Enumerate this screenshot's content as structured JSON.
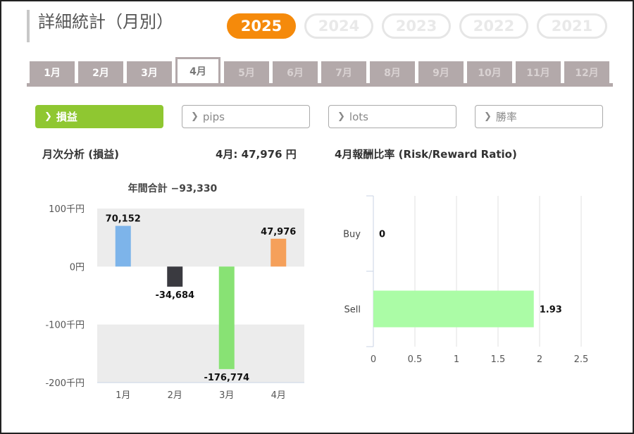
{
  "page_title": "詳細統計（月別）",
  "years": [
    {
      "label": "2025",
      "active": true
    },
    {
      "label": "2024",
      "active": false
    },
    {
      "label": "2023",
      "active": false
    },
    {
      "label": "2022",
      "active": false
    },
    {
      "label": "2021",
      "active": false
    }
  ],
  "month_tabs": [
    {
      "label": "1月",
      "state": "normal"
    },
    {
      "label": "2月",
      "state": "normal"
    },
    {
      "label": "3月",
      "state": "normal"
    },
    {
      "label": "4月",
      "state": "active"
    },
    {
      "label": "5月",
      "state": "dim"
    },
    {
      "label": "6月",
      "state": "dim"
    },
    {
      "label": "7月",
      "state": "dim"
    },
    {
      "label": "8月",
      "state": "dim"
    },
    {
      "label": "9月",
      "state": "dim"
    },
    {
      "label": "10月",
      "state": "dim"
    },
    {
      "label": "11月",
      "state": "dim"
    },
    {
      "label": "12月",
      "state": "dim"
    }
  ],
  "metric_buttons": [
    {
      "label": "損益",
      "active": true
    },
    {
      "label": "pips",
      "active": false
    },
    {
      "label": "lots",
      "active": false
    },
    {
      "label": "勝率",
      "active": false
    }
  ],
  "section": {
    "monthly_title": "月次分析 (損益)",
    "month_summary": "4月:  47,976 円",
    "ratio_title": "4月報酬比率 (Risk/Reward Ratio)"
  },
  "colors": {
    "accent_orange": "#f58a0b",
    "active_green": "#8fc731",
    "tab_gray": "#b3a9aa"
  },
  "chart_data": [
    {
      "type": "bar",
      "title": "年間合計 −93,330",
      "categories": [
        "1月",
        "2月",
        "3月",
        "4月"
      ],
      "values": [
        70152,
        -34684,
        -176774,
        47976
      ],
      "value_labels": [
        "70,152",
        "-34,684",
        "-176,774",
        "47,976"
      ],
      "colors": [
        "#7db4ea",
        "#3a3a40",
        "#88e274",
        "#f5a05a"
      ],
      "ylim": [
        -200000,
        100000
      ],
      "yticks": [
        100000,
        0,
        -100000,
        -200000
      ],
      "ytick_labels": [
        "100千円",
        "0円",
        "-100千円",
        "-200千円"
      ],
      "grid": false
    },
    {
      "type": "bar",
      "orientation": "horizontal",
      "categories": [
        "Buy",
        "Sell"
      ],
      "values": [
        0,
        1.93
      ],
      "value_labels": [
        "0",
        "1.93"
      ],
      "color": "#abfca6",
      "xlim": [
        0,
        2.5
      ],
      "xticks": [
        0,
        0.5,
        1,
        1.5,
        2,
        2.5
      ],
      "xtick_labels": [
        "0",
        "0.5",
        "1",
        "1.5",
        "2",
        "2.5"
      ],
      "grid": true
    }
  ]
}
